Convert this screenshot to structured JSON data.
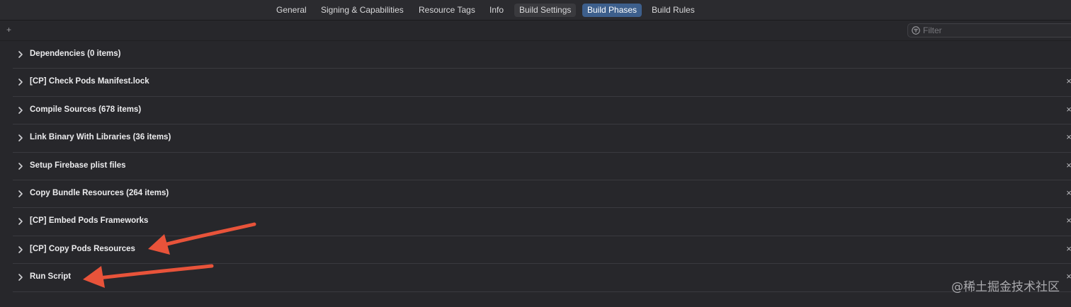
{
  "tabs": {
    "general": "General",
    "signing": "Signing & Capabilities",
    "resource_tags": "Resource Tags",
    "info": "Info",
    "build_settings": "Build Settings",
    "build_phases": "Build Phases",
    "build_rules": "Build Rules"
  },
  "toolbar": {
    "add_label": "+",
    "filter_placeholder": "Filter",
    "filter_icon": "filter-icon"
  },
  "phases": [
    {
      "title": "Dependencies (0 items)",
      "deletable": false
    },
    {
      "title": "[CP] Check Pods Manifest.lock",
      "deletable": true
    },
    {
      "title": "Compile Sources (678 items)",
      "deletable": true
    },
    {
      "title": "Link Binary With Libraries (36 items)",
      "deletable": true
    },
    {
      "title": "Setup Firebase plist files",
      "deletable": true
    },
    {
      "title": "Copy Bundle Resources (264 items)",
      "deletable": true
    },
    {
      "title": "[CP] Embed Pods Frameworks",
      "deletable": true
    },
    {
      "title": "[CP] Copy Pods Resources",
      "deletable": true
    },
    {
      "title": "Run Script",
      "deletable": true
    }
  ],
  "delete_glyph": "×",
  "watermark": "@稀土掘金技术社区",
  "colors": {
    "background": "#27272b",
    "active_tab": "#3d5f8c",
    "annotation_arrow": "#e8533a"
  }
}
